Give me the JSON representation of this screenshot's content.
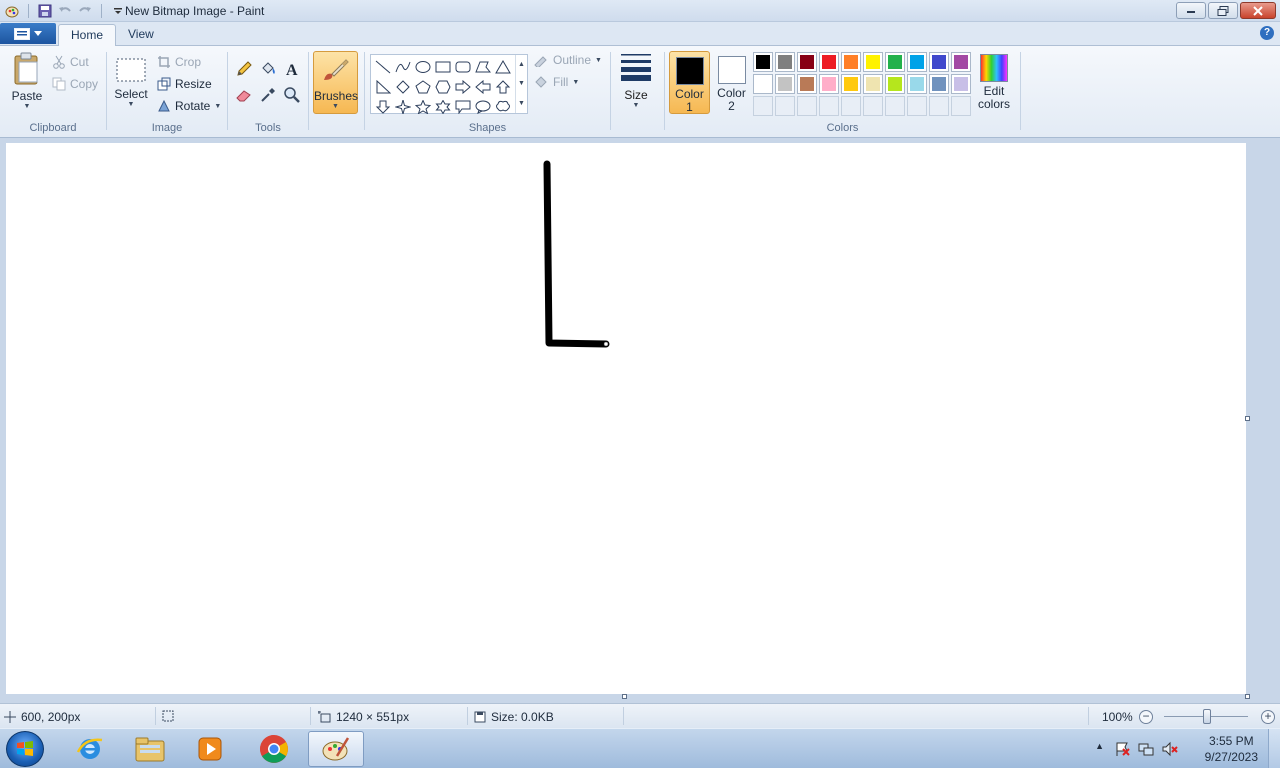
{
  "window": {
    "title": "New Bitmap Image - Paint"
  },
  "tabs": [
    {
      "label": "Home",
      "active": true
    },
    {
      "label": "View",
      "active": false
    }
  ],
  "clipboard": {
    "group_label": "Clipboard",
    "paste": "Paste",
    "cut": "Cut",
    "copy": "Copy"
  },
  "image": {
    "group_label": "Image",
    "select": "Select",
    "crop": "Crop",
    "resize": "Resize",
    "rotate": "Rotate"
  },
  "tools": {
    "group_label": "Tools",
    "icons": [
      "pencil-icon",
      "fill-icon",
      "text-icon",
      "eraser-icon",
      "color-picker-icon",
      "magnifier-icon"
    ]
  },
  "brushes": {
    "label": "Brushes"
  },
  "shapes": {
    "group_label": "Shapes",
    "outline": "Outline",
    "fill": "Fill"
  },
  "size": {
    "label": "Size"
  },
  "colors": {
    "group_label": "Colors",
    "color1": {
      "label": "Color 1",
      "value": "#000000"
    },
    "color2": {
      "label": "Color 2",
      "value": "#ffffff"
    },
    "edit_colors": "Edit colors",
    "palette_row1": [
      "#000000",
      "#7f7f7f",
      "#880015",
      "#ed1c24",
      "#ff7f27",
      "#fff200",
      "#22b14c",
      "#00a2e8",
      "#3f48cc",
      "#a349a4"
    ],
    "palette_row2": [
      "#ffffff",
      "#c3c3c3",
      "#b97a57",
      "#ffaec9",
      "#ffc90e",
      "#efe4b0",
      "#b5e61d",
      "#99d9ea",
      "#7092be",
      "#c8bfe7"
    ]
  },
  "status": {
    "cursor_position": "600, 200px",
    "canvas_size": "1240 × 551px",
    "file_size": "Size: 0.0KB",
    "zoom": "100%"
  },
  "taskbar": {
    "apps": [
      "internet-explorer-icon",
      "file-explorer-icon",
      "media-player-icon",
      "chrome-icon",
      "paint-icon"
    ],
    "time": "3:55 PM",
    "date": "9/27/2023"
  }
}
